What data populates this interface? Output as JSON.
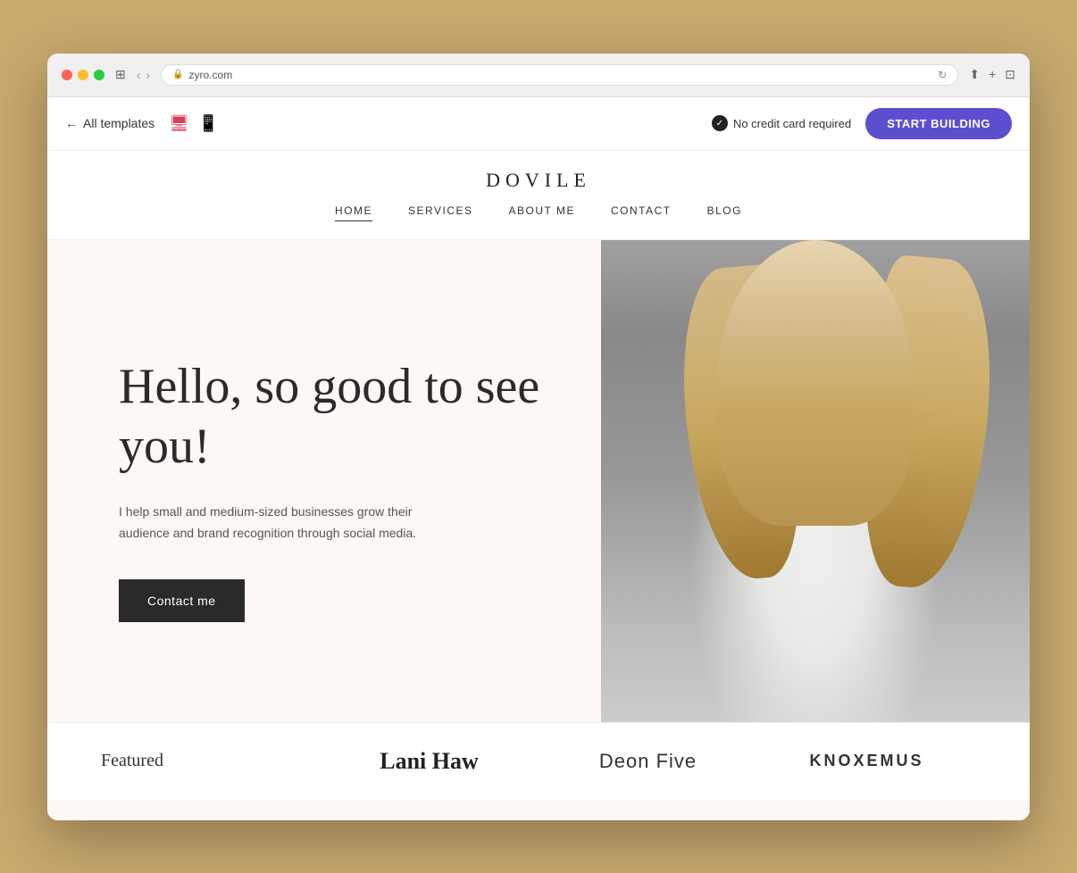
{
  "browser": {
    "url": "zyro.com",
    "tab_icon": "🛡"
  },
  "toolbar": {
    "back_label": "All templates",
    "no_cc_label": "No credit card required",
    "start_building_label": "START BUILDING"
  },
  "site": {
    "logo": "DOVILE",
    "nav_items": [
      {
        "label": "HOME",
        "active": true
      },
      {
        "label": "SERVICES",
        "active": false
      },
      {
        "label": "ABOUT ME",
        "active": false
      },
      {
        "label": "CONTACT",
        "active": false
      },
      {
        "label": "BLOG",
        "active": false
      }
    ],
    "hero": {
      "headline": "Hello, so good to see you!",
      "subtext": "I help small and medium-sized businesses grow their audience and brand recognition through social media.",
      "cta_label": "Contact me"
    },
    "featured": {
      "label": "Featured",
      "brands": [
        {
          "name": "Lani Haw",
          "style": "serif-bold"
        },
        {
          "name": "Deon Five",
          "style": "sans"
        },
        {
          "name": "KNOXEMUS",
          "style": "caps-spaced"
        }
      ]
    }
  }
}
